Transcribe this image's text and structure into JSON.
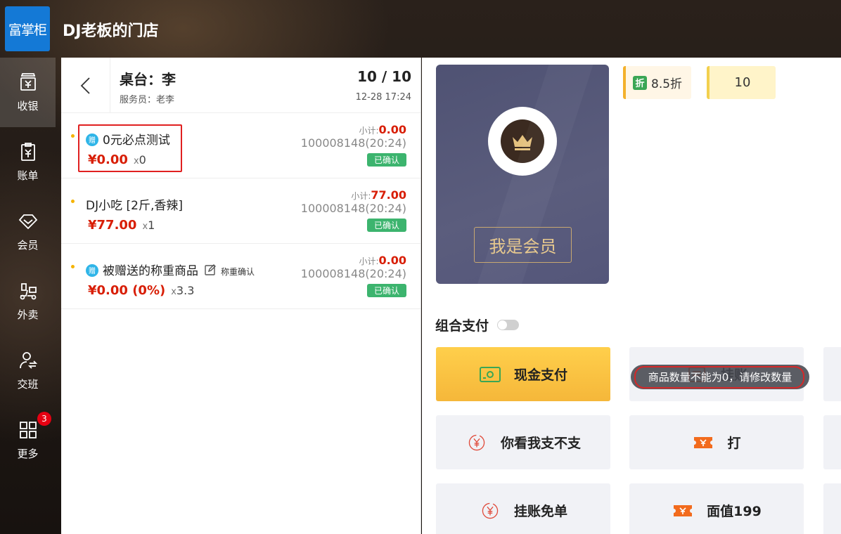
{
  "header": {
    "logo_text": "富掌柜",
    "store_name": "DJ老板的门店"
  },
  "sidebar": {
    "items": [
      {
        "label": "收银"
      },
      {
        "label": "账单"
      },
      {
        "label": "会员"
      },
      {
        "label": "外卖"
      },
      {
        "label": "交班"
      },
      {
        "label": "更多",
        "badge": "3"
      }
    ]
  },
  "order": {
    "table_label": "桌台：李",
    "waiter": "服务员：老李",
    "count": "10 / 10",
    "time": "12-28 17:24",
    "items": [
      {
        "gift": "赠",
        "name": "0元必点测试",
        "price": "¥0.00",
        "qty": "0",
        "subtotal_label": "小计:",
        "subtotal": "0.00",
        "code": "100008148(20:24)",
        "status": "已确认"
      },
      {
        "name": "DJ小吃 [2斤,香辣]",
        "price": "¥77.00",
        "qty": "1",
        "subtotal_label": "小计:",
        "subtotal": "77.00",
        "code": "100008148(20:24)",
        "status": "已确认"
      },
      {
        "gift": "赠",
        "name": "被赠送的称重商品",
        "weigh_label": "称重确认",
        "price": "¥0.00 (0%)",
        "qty": "3.3",
        "subtotal_label": "小计:",
        "subtotal": "0.00",
        "code": "100008148(20:24)",
        "status": "已确认"
      }
    ],
    "qty_prefix": "x"
  },
  "member": {
    "button_label": "我是会员"
  },
  "discount": {
    "label": "8.5折",
    "icon_text": "折"
  },
  "points": {
    "value": "10"
  },
  "payment": {
    "combo_label": "组合支付",
    "buttons": [
      {
        "label": "现金支付",
        "icon": "cash-icon"
      },
      {
        "label": "挂账",
        "icon": "ledger-icon"
      },
      {
        "label": "你看我支不支",
        "icon": "yuan-circle-icon"
      },
      {
        "label": "打",
        "icon": "ticket-icon"
      },
      {
        "label": "挂账免单",
        "icon": "yuan-circle-icon"
      },
      {
        "label": "面值199",
        "icon": "ticket-icon"
      }
    ]
  },
  "toast": {
    "message": "商品数量不能为0，请修改数量"
  },
  "colors": {
    "brand": "#1479d6",
    "price": "#d81e06",
    "confirm": "#3cb46e",
    "primary_pay": "#f5b73a"
  }
}
